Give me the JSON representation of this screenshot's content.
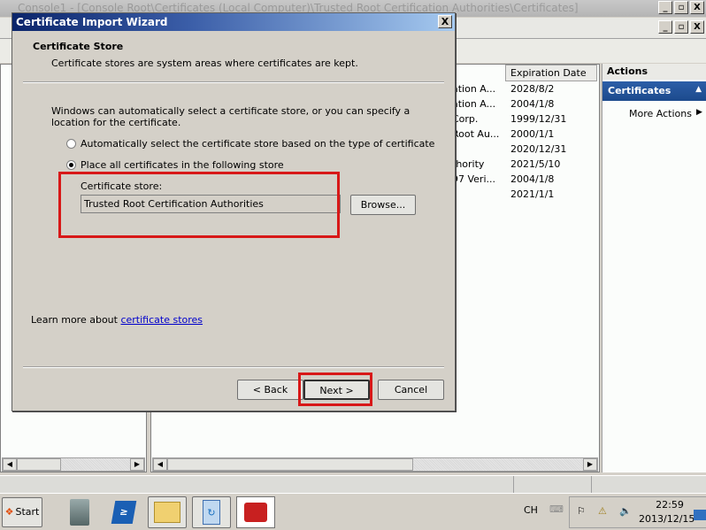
{
  "window": {
    "title": "Console1 - [Console Root\\Certificates (Local Computer)\\Trusted Root Certification Authorities\\Certificates]",
    "min": "_",
    "max": "▫",
    "close": "X"
  },
  "list": {
    "expiration_header": "Expiration Date",
    "rows": [
      {
        "issued": "ation A...",
        "expires": "2028/8/2"
      },
      {
        "issued": "ation A...",
        "expires": "2004/1/8"
      },
      {
        "issued": "Corp.",
        "expires": "1999/12/31"
      },
      {
        "issued": "Root Au...",
        "expires": "2000/1/1"
      },
      {
        "issued": "",
        "expires": "2020/12/31"
      },
      {
        "issued": "thority",
        "expires": "2021/5/10"
      },
      {
        "issued": "97 Veri...",
        "expires": "2004/1/8"
      },
      {
        "issued": "",
        "expires": "2021/1/1"
      }
    ]
  },
  "actions": {
    "header": "Actions",
    "section": "Certificates",
    "more": "More Actions"
  },
  "dialog": {
    "title": "Certificate Import Wizard",
    "close": "X",
    "heading": "Certificate Store",
    "subheading": "Certificate stores are system areas where certificates are kept.",
    "intro": "Windows can automatically select a certificate store, or you can specify a location for the certificate.",
    "option_auto": "Automatically select the certificate store based on the type of certificate",
    "option_manual": "Place all certificates in the following store",
    "selected_option": "manual",
    "store_label": "Certificate store:",
    "store_value": "Trusted Root Certification Authorities",
    "browse": "Browse...",
    "learn_prefix": "Learn more about ",
    "learn_link": "certificate stores",
    "back": "< Back",
    "next": "Next >",
    "cancel": "Cancel"
  },
  "taskbar": {
    "start": "Start",
    "lang": "CH",
    "time": "22:59",
    "date": "2013/12/15"
  },
  "colors": {
    "highlight": "#d81818",
    "actions_header": "#1c4a8c"
  }
}
